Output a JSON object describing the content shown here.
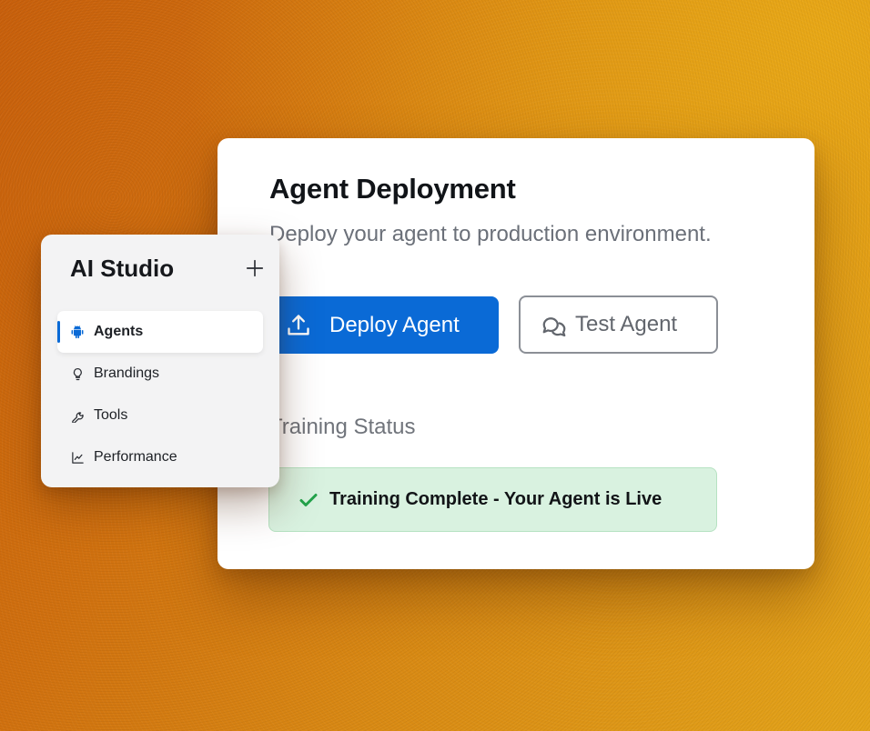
{
  "deployment": {
    "title": "Agent Deployment",
    "subtitle": "Deploy your agent to production environment.",
    "deploy_button": "Deploy Agent",
    "test_button": "Test Agent",
    "status_heading": "Training Status",
    "status_message": "Training Complete - Your Agent is Live",
    "deploy_icon": "upload-icon",
    "test_icon": "chat-bubbles-icon",
    "status_icon": "check-icon"
  },
  "sidebar": {
    "title": "AI Studio",
    "add_icon": "plus-icon",
    "items": [
      {
        "label": "Agents",
        "icon": "android-icon",
        "active": true
      },
      {
        "label": "Brandings",
        "icon": "lightbulb-icon",
        "active": false
      },
      {
        "label": "Tools",
        "icon": "wrench-icon",
        "active": false
      },
      {
        "label": "Performance",
        "icon": "line-chart-icon",
        "active": false
      }
    ]
  },
  "colors": {
    "primary": "#0a6ad6",
    "success_bg": "#d9f2e0",
    "success_check": "#22a34a",
    "background_start": "#c8600c",
    "background_end": "#e3a41a"
  }
}
